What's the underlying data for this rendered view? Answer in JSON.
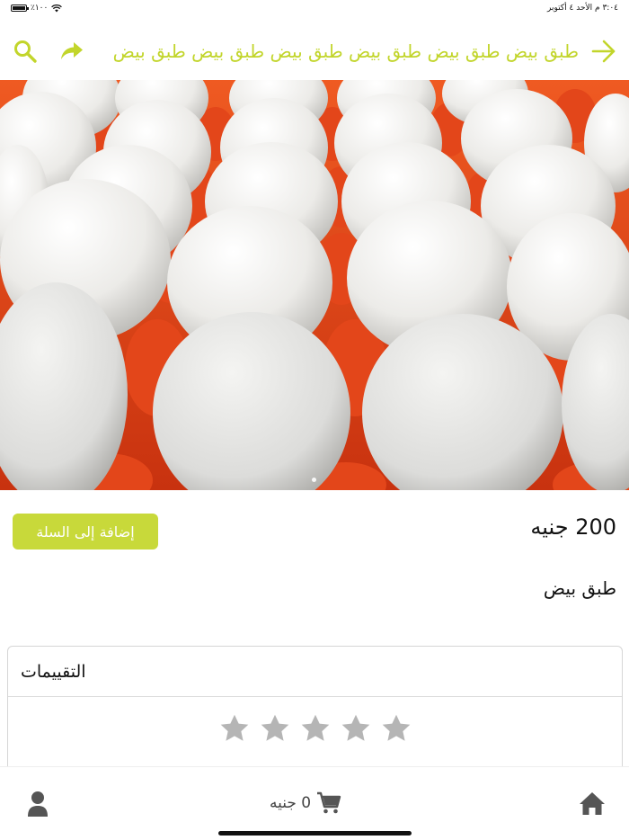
{
  "status_bar": {
    "time_date": "٣:٠٤ م  الأحد ٤ أكتوبر",
    "battery": "٪١٠٠"
  },
  "header": {
    "title": "طبق بيض طبق بيض طبق بيض طبق بيض طبق بيض طبق بيض",
    "icons": [
      "back-arrow-icon",
      "share-icon",
      "search-icon"
    ]
  },
  "hero": {
    "image_alt": "eggs in red tray",
    "page_indicator_count": 1
  },
  "product": {
    "price": "200 جنيه",
    "add_to_cart_label": "إضافة إلى السلة",
    "name": "طبق بيض"
  },
  "ratings": {
    "title": "التقييمات",
    "stars_total": 5,
    "stars_filled": 0
  },
  "tab_bar": {
    "cart_total": "0 جنيه",
    "icons": [
      "home-icon",
      "cart-icon",
      "user-icon"
    ]
  },
  "colors": {
    "accent": "#c8d93a",
    "accent_text": "#c2d52b",
    "star_gray": "#b5b5b5"
  }
}
